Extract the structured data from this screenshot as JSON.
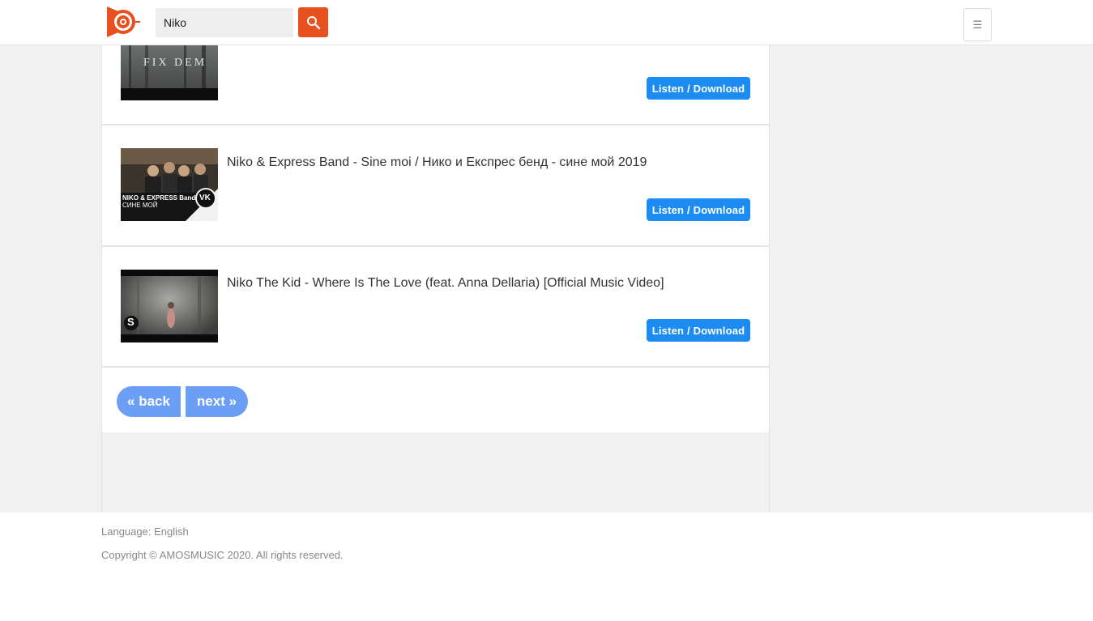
{
  "header": {
    "search_value": "Niko",
    "menu_icon": "☰"
  },
  "results": [
    {
      "title": "",
      "thumb_text": "FIX DEM",
      "button": "Listen / Download"
    },
    {
      "title": "Niko & Express Band - Sine moi / Нико и Експрес бенд - сине мой 2019",
      "thumb_text_1": "NIKO & EXPRESS Band",
      "thumb_text_2": "СИНЕ МОЙ",
      "thumb_badge": "VK",
      "button": "Listen / Download"
    },
    {
      "title": "Niko The Kid - Where Is The Love (feat. Anna Dellaria) [Official Music Video]",
      "thumb_badge": "S",
      "button": "Listen / Download"
    }
  ],
  "pagination": {
    "back": "« back",
    "next": "next »"
  },
  "footer": {
    "language": "Language: English",
    "copyright": "Copyright © AMOSMUSIC 2020. All rights reserved."
  },
  "colors": {
    "brand": "#e8501f",
    "download": "#1d8cf2",
    "pager": "#6a9ff5"
  }
}
